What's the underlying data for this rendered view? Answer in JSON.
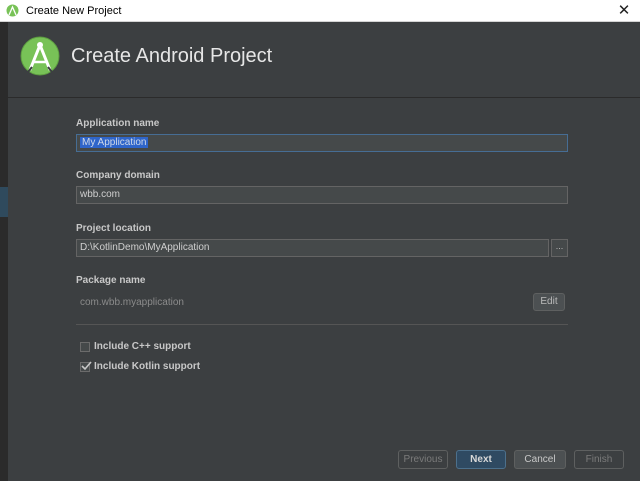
{
  "window": {
    "title": "Create New Project",
    "close_glyph": "✕"
  },
  "header": {
    "title": "Create Android Project",
    "logo_icon": "android-studio-logo-icon"
  },
  "form": {
    "app_name": {
      "label": "Application name",
      "value": "My Application"
    },
    "company_domain": {
      "label": "Company domain",
      "value": "wbb.com"
    },
    "project_location": {
      "label": "Project location",
      "value": "D:\\KotlinDemo\\MyApplication",
      "browse_label": "..."
    },
    "package_name": {
      "label": "Package name",
      "value": "com.wbb.myapplication",
      "edit_label": "Edit"
    },
    "cpp_support": {
      "label": "Include C++ support",
      "checked": false
    },
    "kotlin_support": {
      "label": "Include Kotlin support",
      "checked": true
    }
  },
  "buttons": {
    "previous": "Previous",
    "next": "Next",
    "cancel": "Cancel",
    "finish": "Finish"
  },
  "colors": {
    "background": "#3c3f41",
    "accent": "#2f65ca",
    "logo_green": "#78c257"
  }
}
